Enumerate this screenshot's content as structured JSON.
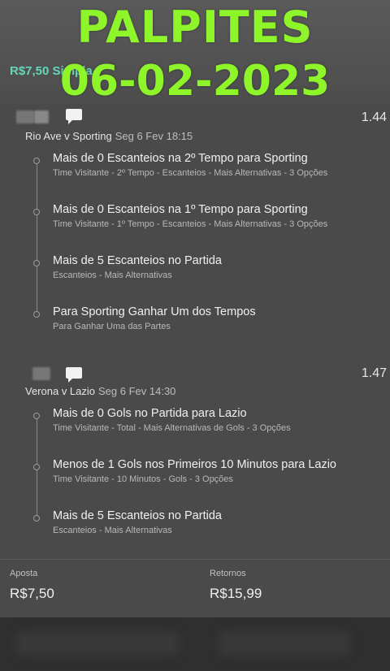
{
  "overlay": {
    "line1": "PALPITES",
    "line2": "06-02-2023"
  },
  "header": {
    "amount": "R$7,50 Simpla"
  },
  "bets": [
    {
      "odds": "1.44",
      "match": "Rio Ave v Sporting",
      "date": "Seg 6 Fev 18:15",
      "legs": [
        {
          "title": "Mais de 0 Escanteios na 2º Tempo para Sporting",
          "sub": "Time Visitante - 2º Tempo - Escanteios - Mais Alternativas - 3 Opções"
        },
        {
          "title": "Mais de 0 Escanteios na 1º Tempo para Sporting",
          "sub": "Time Visitante - 1º Tempo - Escanteios - Mais Alternativas - 3 Opções"
        },
        {
          "title": "Mais de 5 Escanteios no Partida",
          "sub": "Escanteios - Mais Alternativas"
        },
        {
          "title": "Para Sporting Ganhar Um dos Tempos",
          "sub": "Para Ganhar Uma das Partes"
        }
      ]
    },
    {
      "odds": "1.47",
      "match": "Verona v Lazio",
      "date": "Seg 6 Fev 14:30",
      "legs": [
        {
          "title": "Mais de 0 Gols no Partida para Lazio",
          "sub": "Time Visitante - Total - Mais Alternativas de Gols - 3 Opções"
        },
        {
          "title": "Menos de 1 Gols nos Primeiros 10 Minutos para Lazio",
          "sub": "Time Visitante - 10 Minutos - Gols - 3 Opções"
        },
        {
          "title": "Mais de 5 Escanteios no Partida",
          "sub": "Escanteios - Mais Alternativas"
        }
      ]
    }
  ],
  "footer": {
    "stake_label": "Aposta",
    "stake_value": "R$7,50",
    "returns_label": "Retornos",
    "returns_value": "R$15,99"
  },
  "colors": {
    "overlay": "#8ef52a",
    "accent": "#66d6b8",
    "background": "#4a4a4a"
  }
}
